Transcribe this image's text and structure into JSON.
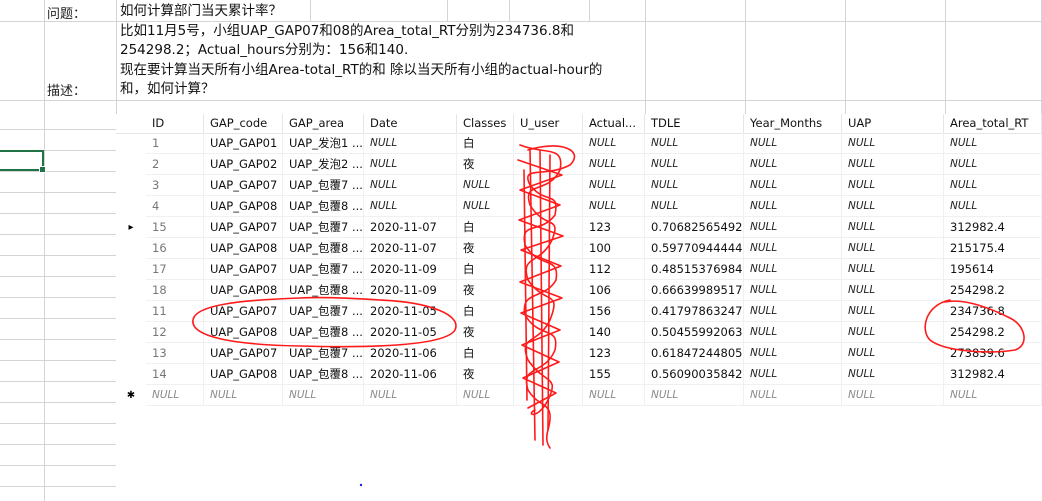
{
  "sheet": {
    "label_question": "问题：",
    "label_desc": "描述：",
    "question": "如何计算部门当天累计率？",
    "desc_lines": [
      "比如11月5号，小组UAP_GAP07和08的Area_total_RT分别为234736.8和",
      "254298.2；Actual_hours分别为：156和140.",
      "现在要计算当天所有小组Area-total_RT的和 除以当天所有小组的actual-hour的",
      "和，如何计算？"
    ]
  },
  "columns": [
    "ID",
    "GAP_code",
    "GAP_area",
    "Date",
    "Classes",
    "U_user",
    "Actual...",
    "TDLE",
    "Year_Months",
    "UAP",
    "Area_total_RT"
  ],
  "rows": [
    {
      "marker": "",
      "id": "1",
      "gap_code": "UAP_GAP01",
      "gap_area": "UAP_发泡1 ...",
      "date": "NULL",
      "classes": "白",
      "u_user": "",
      "actual": "NULL",
      "tdle": "NULL",
      "year_months": "NULL",
      "uap": "NULL",
      "area_total_rt": "NULL"
    },
    {
      "marker": "",
      "id": "2",
      "gap_code": "UAP_GAP02",
      "gap_area": "UAP_发泡2 ...",
      "date": "NULL",
      "classes": "夜",
      "u_user": "",
      "actual": "NULL",
      "tdle": "NULL",
      "year_months": "NULL",
      "uap": "NULL",
      "area_total_rt": "NULL"
    },
    {
      "marker": "",
      "id": "3",
      "gap_code": "UAP_GAP07",
      "gap_area": "UAP_包覆7 ...",
      "date": "NULL",
      "classes": "NULL",
      "u_user": "",
      "actual": "NULL",
      "tdle": "NULL",
      "year_months": "NULL",
      "uap": "NULL",
      "area_total_rt": "NULL"
    },
    {
      "marker": "",
      "id": "4",
      "gap_code": "UAP_GAP08",
      "gap_area": "UAP_包覆8 ...",
      "date": "NULL",
      "classes": "NULL",
      "u_user": "",
      "actual": "NULL",
      "tdle": "NULL",
      "year_months": "NULL",
      "uap": "NULL",
      "area_total_rt": "NULL"
    },
    {
      "marker": "▸",
      "id": "15",
      "gap_code": "UAP_GAP07",
      "gap_area": "UAP_包覆7 ...",
      "date": "2020-11-07",
      "classes": "白",
      "u_user": "",
      "actual": "123",
      "tdle": "0.70682565492...",
      "year_months": "NULL",
      "uap": "NULL",
      "area_total_rt": "312982.4"
    },
    {
      "marker": "",
      "id": "16",
      "gap_code": "UAP_GAP08",
      "gap_area": "UAP_包覆8 ...",
      "date": "2020-11-07",
      "classes": "夜",
      "u_user": "",
      "actual": "100",
      "tdle": "0.59770944444...",
      "year_months": "NULL",
      "uap": "NULL",
      "area_total_rt": "215175.4"
    },
    {
      "marker": "",
      "id": "17",
      "gap_code": "UAP_GAP07",
      "gap_area": "UAP_包覆7 ...",
      "date": "2020-11-09",
      "classes": "白",
      "u_user": "",
      "actual": "112",
      "tdle": "0.48515376984...",
      "year_months": "NULL",
      "uap": "NULL",
      "area_total_rt": "195614"
    },
    {
      "marker": "",
      "id": "18",
      "gap_code": "UAP_GAP08",
      "gap_area": "UAP_包覆8 ...",
      "date": "2020-11-09",
      "classes": "夜",
      "u_user": "",
      "actual": "106",
      "tdle": "0.66639989517...",
      "year_months": "NULL",
      "uap": "NULL",
      "area_total_rt": "254298.2"
    },
    {
      "marker": "",
      "id": "11",
      "gap_code": "UAP_GAP07",
      "gap_area": "UAP_包覆7 ...",
      "date": "2020-11-05",
      "classes": "白",
      "u_user": "",
      "actual": "156",
      "tdle": "0.41797863247...",
      "year_months": "NULL",
      "uap": "NULL",
      "area_total_rt": "234736.8"
    },
    {
      "marker": "",
      "id": "12",
      "gap_code": "UAP_GAP08",
      "gap_area": "UAP_包覆8 ...",
      "date": "2020-11-05",
      "classes": "夜",
      "u_user": "",
      "actual": "140",
      "tdle": "0.50455992063...",
      "year_months": "NULL",
      "uap": "NULL",
      "area_total_rt": "254298.2"
    },
    {
      "marker": "",
      "id": "13",
      "gap_code": "UAP_GAP07",
      "gap_area": "UAP_包覆7 ...",
      "date": "2020-11-06",
      "classes": "白",
      "u_user": "",
      "actual": "123",
      "tdle": "0.61847244805...",
      "year_months": "NULL",
      "uap": "NULL",
      "area_total_rt": "273839.6"
    },
    {
      "marker": "",
      "id": "14",
      "gap_code": "UAP_GAP08",
      "gap_area": "UAP_包覆8 ...",
      "date": "2020-11-06",
      "classes": "夜",
      "u_user": "",
      "actual": "155",
      "tdle": "0.56090035842...",
      "year_months": "NULL",
      "uap": "NULL",
      "area_total_rt": "312982.4"
    },
    {
      "marker": "✱",
      "id": "NULL",
      "gap_code": "NULL",
      "gap_area": "NULL",
      "date": "NULL",
      "classes": "NULL",
      "u_user": "",
      "actual": "NULL",
      "tdle": "NULL",
      "year_months": "NULL",
      "uap": "NULL",
      "area_total_rt": "NULL",
      "is_new": true
    }
  ],
  "colors": {
    "annotation": "#ff1a1a",
    "selection": "#217346",
    "gridline": "#d4d4d4"
  }
}
